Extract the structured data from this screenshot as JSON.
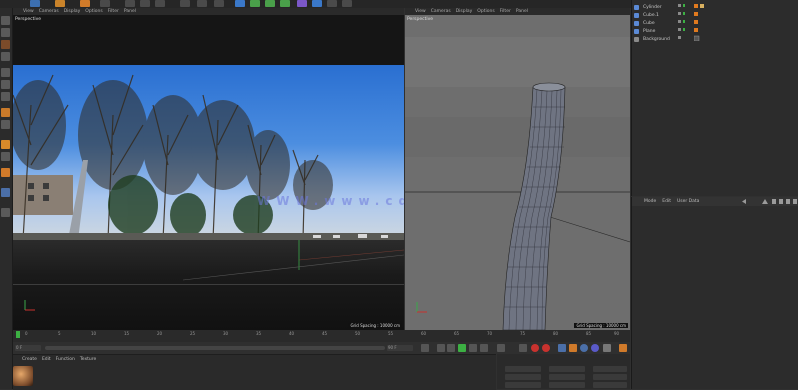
{
  "viewport_left": {
    "menu": [
      "View",
      "Cameras",
      "Display",
      "Options",
      "Filter",
      "Panel"
    ],
    "title": "Perspective",
    "grid_spacing": "Grid Spacing : 10000 cm"
  },
  "viewport_right": {
    "menu": [
      "View",
      "Cameras",
      "Display",
      "Options",
      "Filter",
      "Panel"
    ],
    "title": "Perspective",
    "grid_spacing": "Grid Spacing : 10000 cm"
  },
  "object_manager": {
    "objects": [
      {
        "name": "Cylinder",
        "icon": "cylinder-icon",
        "color": "#5b8ad6"
      },
      {
        "name": "Cube.1",
        "icon": "cube-icon",
        "color": "#5b8ad6"
      },
      {
        "name": "Cube",
        "icon": "cube-icon",
        "color": "#5b8ad6"
      },
      {
        "name": "Plane",
        "icon": "plane-icon",
        "color": "#5b8ad6"
      },
      {
        "name": "Background",
        "icon": "background-icon",
        "color": "#8a8a8a"
      }
    ]
  },
  "attribute_manager": {
    "menu": [
      "Mode",
      "Edit",
      "User Data"
    ]
  },
  "timeline": {
    "ticks": [
      "0",
      "5",
      "10",
      "15",
      "20",
      "25",
      "30",
      "35",
      "40",
      "45",
      "50",
      "55",
      "60",
      "65",
      "70",
      "75",
      "80",
      "85",
      "90"
    ],
    "start_frame": "0 F",
    "end_frame": "90 F",
    "current_frame": "0 F",
    "max_frame": "90 F"
  },
  "material_manager": {
    "menu": [
      "Create",
      "Edit",
      "Function",
      "Texture"
    ]
  },
  "watermark": "WWW.www.cdnxxfb.cn",
  "colors": {
    "accent_orange": "#e07a1f",
    "play_green": "#3cb043",
    "record_red": "#c8322e"
  }
}
